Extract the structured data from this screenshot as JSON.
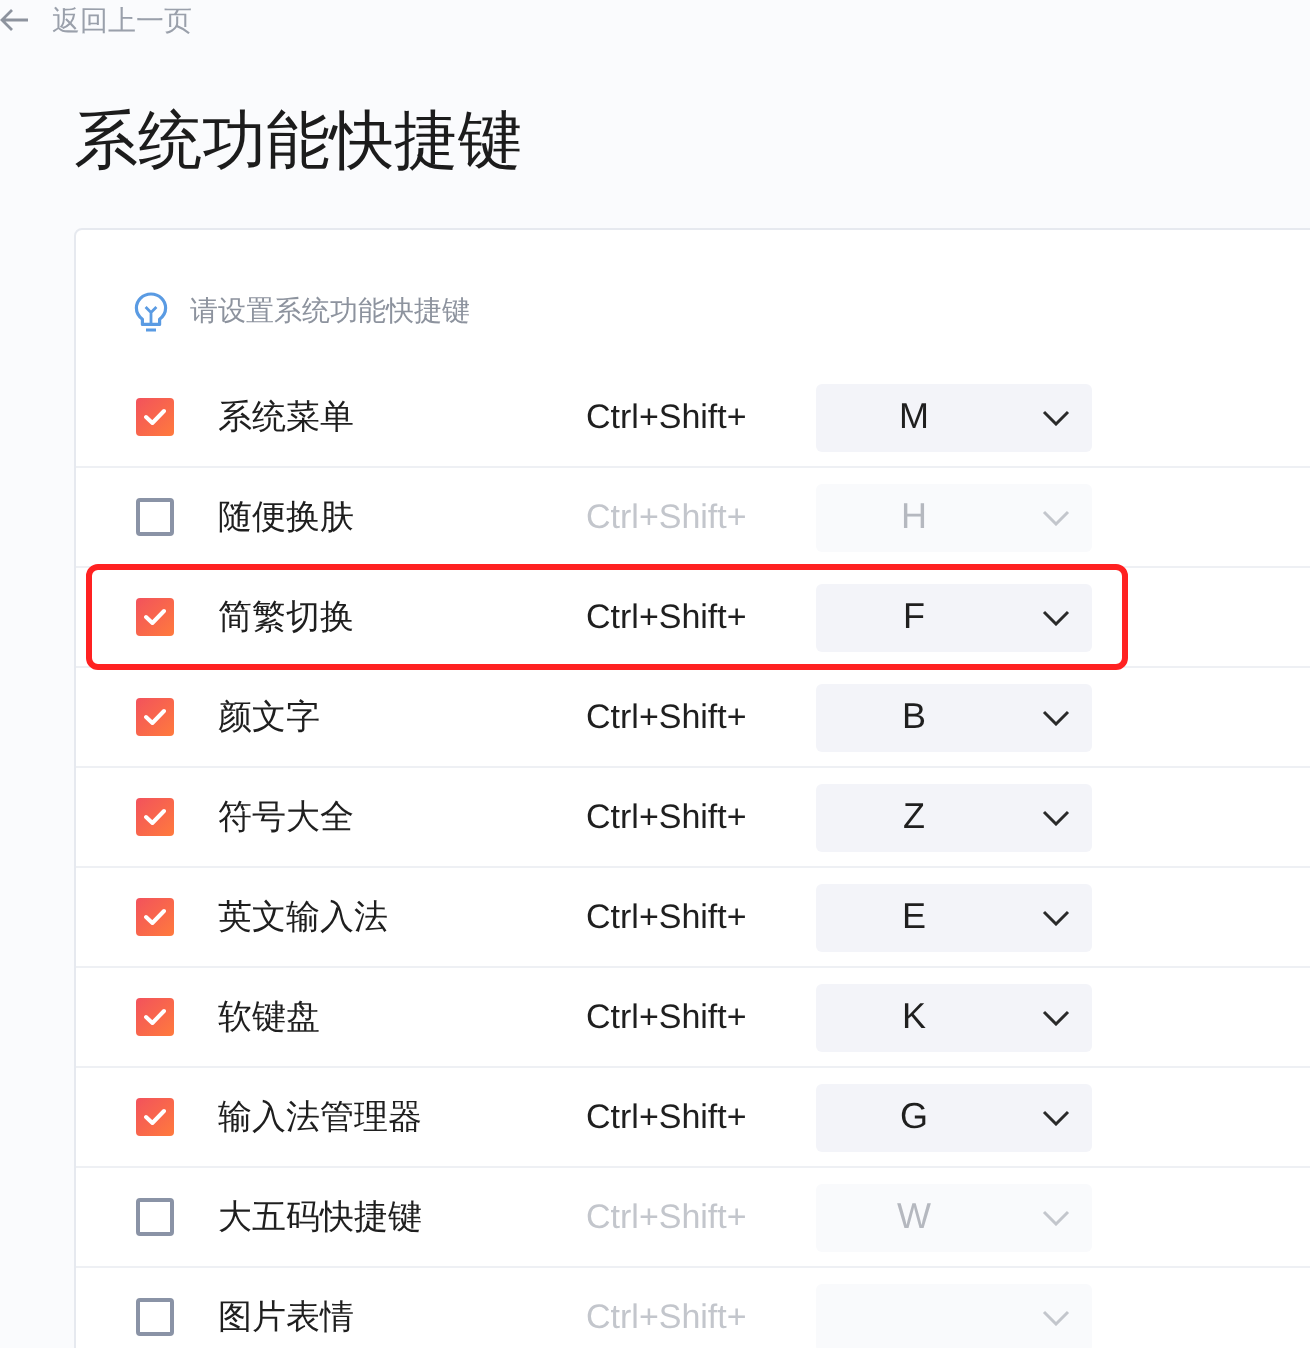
{
  "back_link": {
    "label": "返回上一页"
  },
  "title": "系统功能快捷键",
  "hint": "请设置系统功能快捷键",
  "shortcuts": [
    {
      "name": "系统菜单",
      "checked": true,
      "modifier": "Ctrl+Shift+",
      "key": "M",
      "highlighted": false
    },
    {
      "name": "随便换肤",
      "checked": false,
      "modifier": "Ctrl+Shift+",
      "key": "H",
      "highlighted": false
    },
    {
      "name": "简繁切换",
      "checked": true,
      "modifier": "Ctrl+Shift+",
      "key": "F",
      "highlighted": true
    },
    {
      "name": "颜文字",
      "checked": true,
      "modifier": "Ctrl+Shift+",
      "key": "B",
      "highlighted": false
    },
    {
      "name": "符号大全",
      "checked": true,
      "modifier": "Ctrl+Shift+",
      "key": "Z",
      "highlighted": false
    },
    {
      "name": "英文输入法",
      "checked": true,
      "modifier": "Ctrl+Shift+",
      "key": "E",
      "highlighted": false
    },
    {
      "name": "软键盘",
      "checked": true,
      "modifier": "Ctrl+Shift+",
      "key": "K",
      "highlighted": false
    },
    {
      "name": "输入法管理器",
      "checked": true,
      "modifier": "Ctrl+Shift+",
      "key": "G",
      "highlighted": false
    },
    {
      "name": "大五码快捷键",
      "checked": false,
      "modifier": "Ctrl+Shift+",
      "key": "W",
      "highlighted": false
    },
    {
      "name": "图片表情",
      "checked": false,
      "modifier": "Ctrl+Shift+",
      "highlighted": false
    }
  ]
}
